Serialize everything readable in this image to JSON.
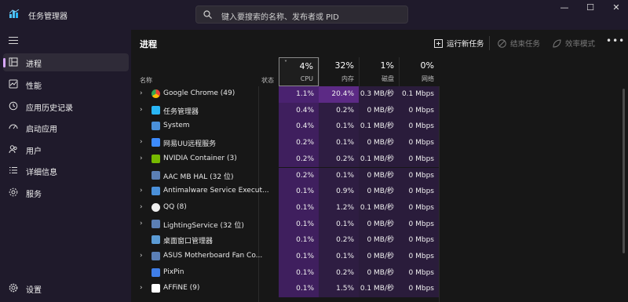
{
  "app": {
    "title": "任务管理器"
  },
  "search": {
    "placeholder": "键入要搜索的名称、发布者或 PID"
  },
  "window_controls": {
    "minimize": "—",
    "maximize": "☐",
    "close": "✕"
  },
  "sidebar": {
    "items": [
      {
        "label": "进程",
        "icon": "processes-icon",
        "active": true
      },
      {
        "label": "性能",
        "icon": "performance-icon"
      },
      {
        "label": "应用历史记录",
        "icon": "history-icon"
      },
      {
        "label": "启动应用",
        "icon": "startup-icon"
      },
      {
        "label": "用户",
        "icon": "users-icon"
      },
      {
        "label": "详细信息",
        "icon": "details-icon"
      },
      {
        "label": "服务",
        "icon": "services-icon"
      }
    ],
    "settings": {
      "label": "设置",
      "icon": "gear-icon"
    }
  },
  "main": {
    "title": "进程",
    "toolbar": {
      "run_new_task": "运行新任务",
      "end_task": "结束任务",
      "efficiency_mode": "效率模式",
      "more": "•••"
    },
    "columns": {
      "name": "名称",
      "status": "状态",
      "cpu": {
        "pct": "4%",
        "label": "CPU"
      },
      "memory": {
        "pct": "32%",
        "label": "内存"
      },
      "disk": {
        "pct": "1%",
        "label": "磁盘"
      },
      "network": {
        "pct": "0%",
        "label": "网络"
      }
    },
    "rows": [
      {
        "expand": "›",
        "name": "Google Chrome (49)",
        "icon": "chrome-icon",
        "cpu": "1.1%",
        "mem": "20.4%",
        "disk": "0.3 MB/秒",
        "net": "0.1 Mbps"
      },
      {
        "expand": "›",
        "name": "任务管理器",
        "icon": "task-manager-icon",
        "cpu": "0.4%",
        "mem": "0.2%",
        "disk": "0 MB/秒",
        "net": "0 Mbps"
      },
      {
        "expand": "",
        "name": "System",
        "icon": "system-icon",
        "cpu": "0.4%",
        "mem": "0.1%",
        "disk": "0.1 MB/秒",
        "net": "0 Mbps"
      },
      {
        "expand": "›",
        "name": "网易UU远程服务",
        "icon": "uu-icon",
        "cpu": "0.2%",
        "mem": "0.1%",
        "disk": "0 MB/秒",
        "net": "0 Mbps"
      },
      {
        "expand": "›",
        "name": "NVIDIA Container (3)",
        "icon": "nvidia-icon",
        "cpu": "0.2%",
        "mem": "0.2%",
        "disk": "0.1 MB/秒",
        "net": "0 Mbps"
      },
      {
        "expand": "",
        "name": "AAC MB HAL (32 位)",
        "icon": "app-icon",
        "cpu": "0.2%",
        "mem": "0.1%",
        "disk": "0 MB/秒",
        "net": "0 Mbps"
      },
      {
        "expand": "›",
        "name": "Antimalware Service Execut...",
        "icon": "shield-icon",
        "cpu": "0.1%",
        "mem": "0.9%",
        "disk": "0 MB/秒",
        "net": "0 Mbps"
      },
      {
        "expand": "›",
        "name": "QQ (8)",
        "icon": "qq-icon",
        "cpu": "0.1%",
        "mem": "1.2%",
        "disk": "0.1 MB/秒",
        "net": "0 Mbps"
      },
      {
        "expand": "›",
        "name": "LightingService (32 位)",
        "icon": "app-icon",
        "cpu": "0.1%",
        "mem": "0.1%",
        "disk": "0 MB/秒",
        "net": "0 Mbps"
      },
      {
        "expand": "",
        "name": "桌面窗口管理器",
        "icon": "dwm-icon",
        "cpu": "0.1%",
        "mem": "0.2%",
        "disk": "0 MB/秒",
        "net": "0 Mbps"
      },
      {
        "expand": "›",
        "name": "ASUS Motherboard Fan Co...",
        "icon": "app-icon",
        "cpu": "0.1%",
        "mem": "0.1%",
        "disk": "0 MB/秒",
        "net": "0 Mbps"
      },
      {
        "expand": "",
        "name": "PixPin",
        "icon": "pixpin-icon",
        "cpu": "0.1%",
        "mem": "0.2%",
        "disk": "0 MB/秒",
        "net": "0 Mbps"
      },
      {
        "expand": "›",
        "name": "AFFiNE (9)",
        "icon": "affine-icon",
        "cpu": "0.1%",
        "mem": "1.5%",
        "disk": "0.1 MB/秒",
        "net": "0 Mbps"
      }
    ]
  },
  "colors": {
    "accent": "#d8a8ff",
    "cpu_heat": "#3f1f5e",
    "mem_heat_high": "#5c2a85"
  }
}
